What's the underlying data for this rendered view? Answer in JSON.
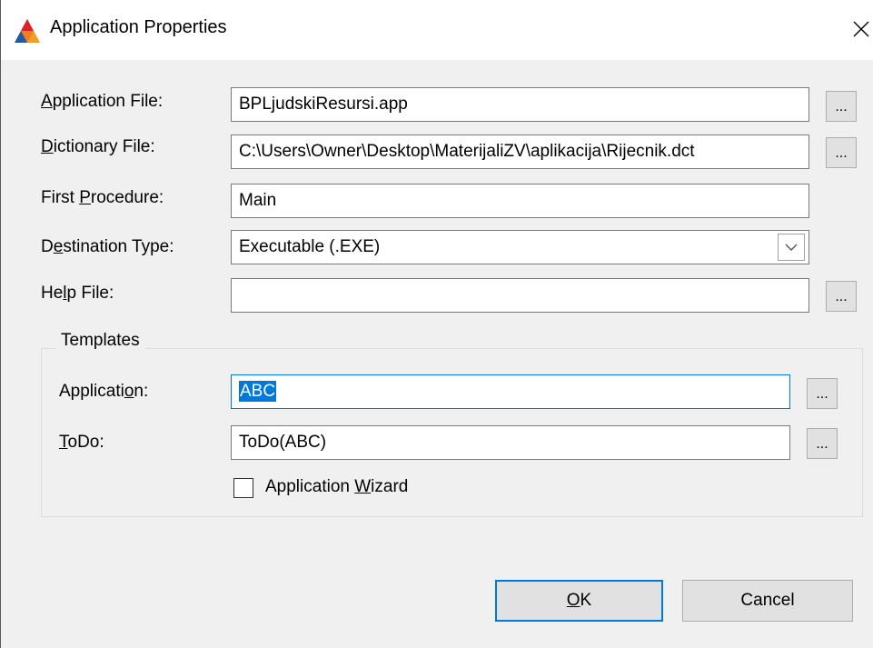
{
  "window": {
    "title": "Application Properties",
    "icon": "clarion-app-icon",
    "close_icon": "close-icon"
  },
  "fields": {
    "application_file": {
      "label_pre": "",
      "label_acc": "A",
      "label_post": "pplication File:",
      "value": "BPLjudskiResursi.app",
      "button": "..."
    },
    "dictionary_file": {
      "label_pre": "",
      "label_acc": "D",
      "label_post": "ictionary File:",
      "value": "C:\\Users\\Owner\\Desktop\\MaterijaliZV\\aplikacija\\Rijecnik.dct",
      "button": "..."
    },
    "first_procedure": {
      "label_pre": "First ",
      "label_acc": "P",
      "label_post": "rocedure:",
      "value": "Main"
    },
    "destination_type": {
      "label_pre": "D",
      "label_acc": "e",
      "label_post": "stination Type:",
      "value": "Executable (.EXE)"
    },
    "help_file": {
      "label_pre": "He",
      "label_acc": "l",
      "label_post": "p File:",
      "value": "",
      "button": "..."
    }
  },
  "templates": {
    "group_label": "Templates",
    "application": {
      "label_pre": "Applicati",
      "label_acc": "o",
      "label_post": "n:",
      "value": "ABC",
      "button": "..."
    },
    "todo": {
      "label_pre": "",
      "label_acc": "T",
      "label_post": "oDo:",
      "value": "ToDo(ABC)",
      "button": "..."
    },
    "wizard": {
      "label_pre": "Application ",
      "label_acc": "W",
      "label_post": "izard",
      "checked": false
    }
  },
  "buttons": {
    "ok": {
      "label_acc": "O",
      "label_post": "K"
    },
    "cancel": {
      "label": "Cancel"
    }
  },
  "colors": {
    "accent": "#0078d7",
    "dialog_bg": "#f0f0f0"
  }
}
